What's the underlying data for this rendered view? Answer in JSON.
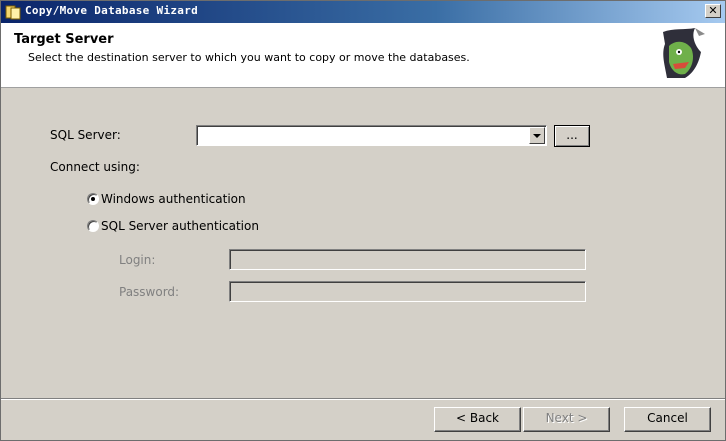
{
  "window": {
    "title": "Copy/Move Database Wizard",
    "close_glyph": "✕"
  },
  "header": {
    "title": "Target Server",
    "subtitle": "Select the destination server to which you want to copy or move the databases."
  },
  "form": {
    "sql_server_label": "SQL Server:",
    "sql_server_value": "",
    "browse_label": "...",
    "connect_using_label": "Connect using:",
    "auth_options": [
      {
        "label": "Windows authentication",
        "selected": true
      },
      {
        "label": "SQL Server authentication",
        "selected": false
      }
    ],
    "login_label": "Login:",
    "login_value": "",
    "password_label": "Password:",
    "password_value": ""
  },
  "footer": {
    "back_label": "< Back",
    "next_label": "Next >",
    "cancel_label": "Cancel"
  },
  "icons": {
    "title": "wizard-app-icon",
    "logo": "sql-server-wizard-logo",
    "dropdown": "chevron-down-icon"
  }
}
